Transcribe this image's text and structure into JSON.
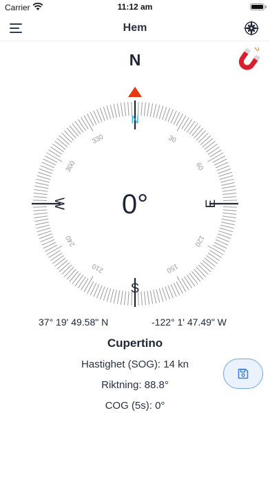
{
  "status_bar": {
    "carrier": "Carrier",
    "time": "11:12 am",
    "icons": [
      "wifi-icon",
      "battery-icon"
    ]
  },
  "nav": {
    "title": "Hem",
    "left_icon": "hamburger-menu-icon",
    "right_icon": "compass-rose-icon"
  },
  "compass": {
    "north_label": "N",
    "heading_display": "0°",
    "heading_degrees": 0,
    "cardinals": {
      "n": "N",
      "e": "E",
      "s": "S",
      "w": "W"
    },
    "degree_labels": [
      "30",
      "60",
      "120",
      "150",
      "210",
      "240",
      "300",
      "330"
    ],
    "magnet_icon": "magnet-icon",
    "indicator_color": "#e8380d",
    "north_accent_color": "#1eb6e8",
    "tick_color": "#9a9a9a"
  },
  "location": {
    "latitude": "37° 19' 49.58\" N",
    "longitude": "-122° 1' 47.49\" W",
    "place": "Cupertino",
    "speed": "Hastighet (SOG): 14 kn",
    "heading": "Riktning: 88.8°",
    "cog": "COG (5s): 0°"
  },
  "actions": {
    "save_icon": "save-icon",
    "save_color": "#3f7fd9"
  }
}
